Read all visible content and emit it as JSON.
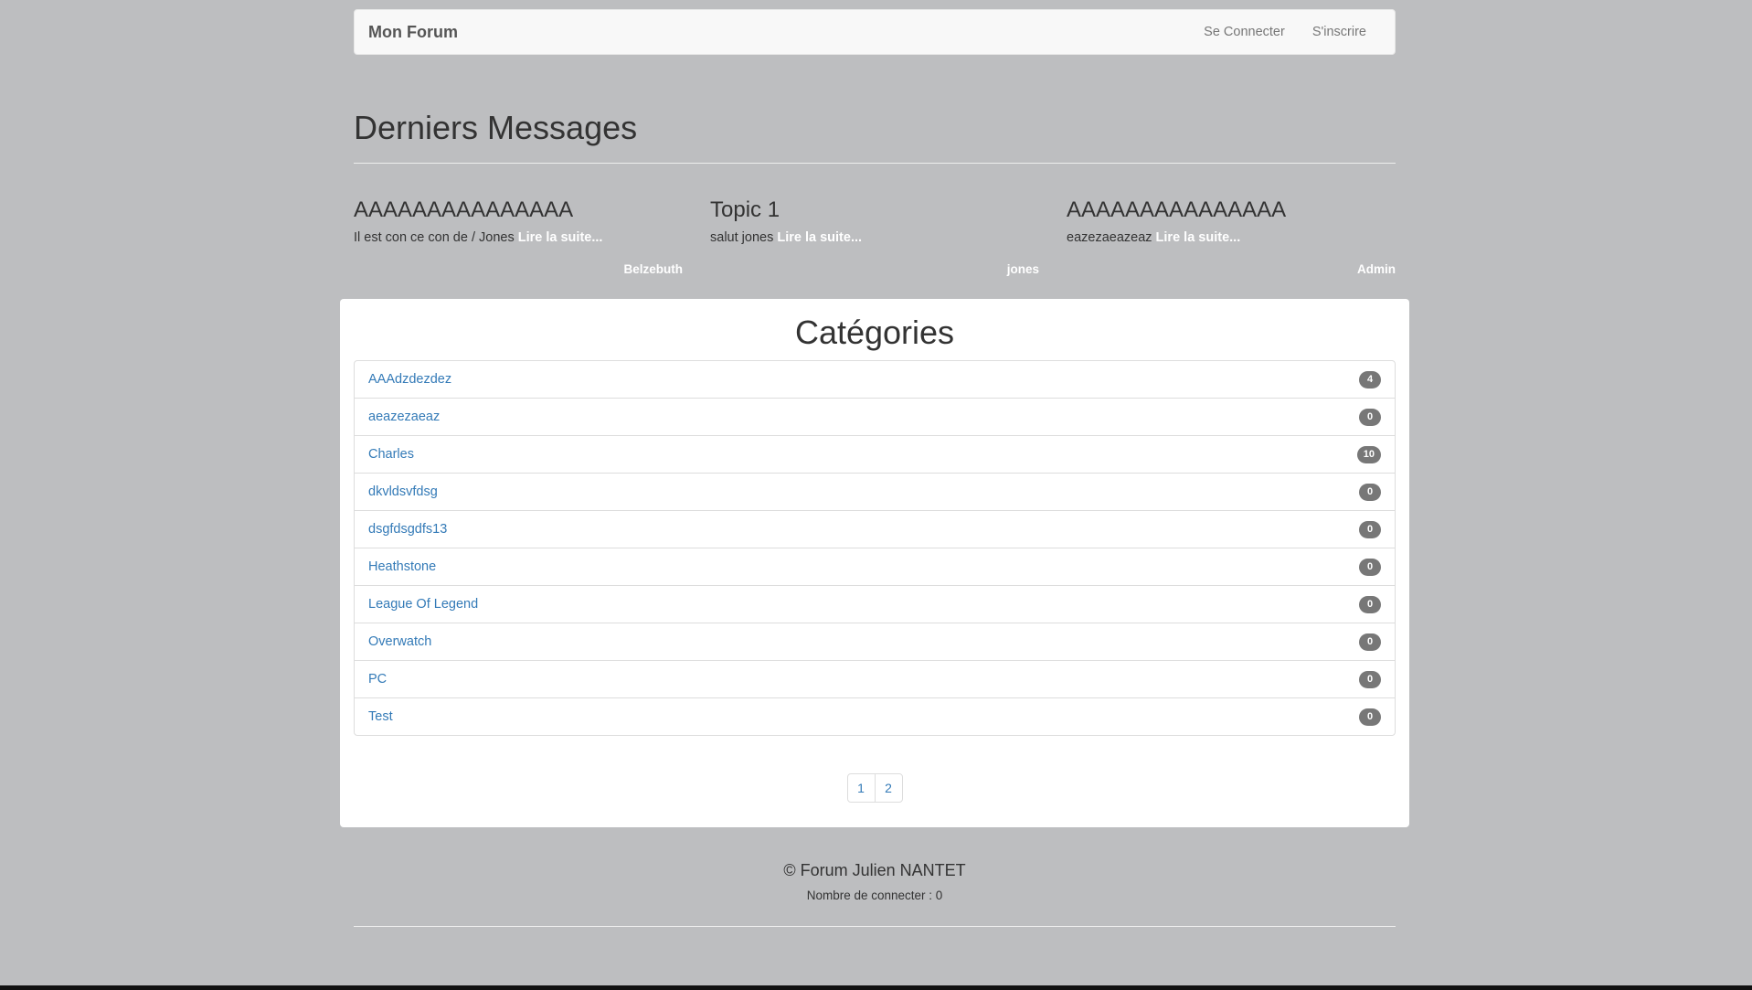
{
  "navbar": {
    "brand": "Mon Forum",
    "login": "Se Connecter",
    "register": "S'inscrire"
  },
  "latest": {
    "title": "Derniers Messages",
    "messages": [
      {
        "title": "AAAAAAAAAAAAAAA",
        "excerpt": "Il est con ce con de / Jones",
        "read_more": "Lire la suite...",
        "author": "Belzebuth"
      },
      {
        "title": "Topic 1",
        "excerpt": "salut jones",
        "read_more": "Lire la suite...",
        "author": "jones"
      },
      {
        "title": "AAAAAAAAAAAAAAA",
        "excerpt": "eazezaeazeaz",
        "read_more": "Lire la suite...",
        "author": "Admin"
      }
    ]
  },
  "categories": {
    "title": "Catégories",
    "items": [
      {
        "name": "AAAdzdezdez",
        "count": "4"
      },
      {
        "name": "aeazezaeaz",
        "count": "0"
      },
      {
        "name": "Charles",
        "count": "10"
      },
      {
        "name": "dkvldsvfdsg",
        "count": "0"
      },
      {
        "name": "dsgfdsgdfs13",
        "count": "0"
      },
      {
        "name": "Heathstone",
        "count": "0"
      },
      {
        "name": "League Of Legend",
        "count": "0"
      },
      {
        "name": "Overwatch",
        "count": "0"
      },
      {
        "name": "PC",
        "count": "0"
      },
      {
        "name": "Test",
        "count": "0"
      }
    ],
    "pages": [
      "1",
      "2"
    ]
  },
  "footer": {
    "copyright": "© Forum Julien NANTET",
    "online": "Nombre de connecter : 0"
  }
}
